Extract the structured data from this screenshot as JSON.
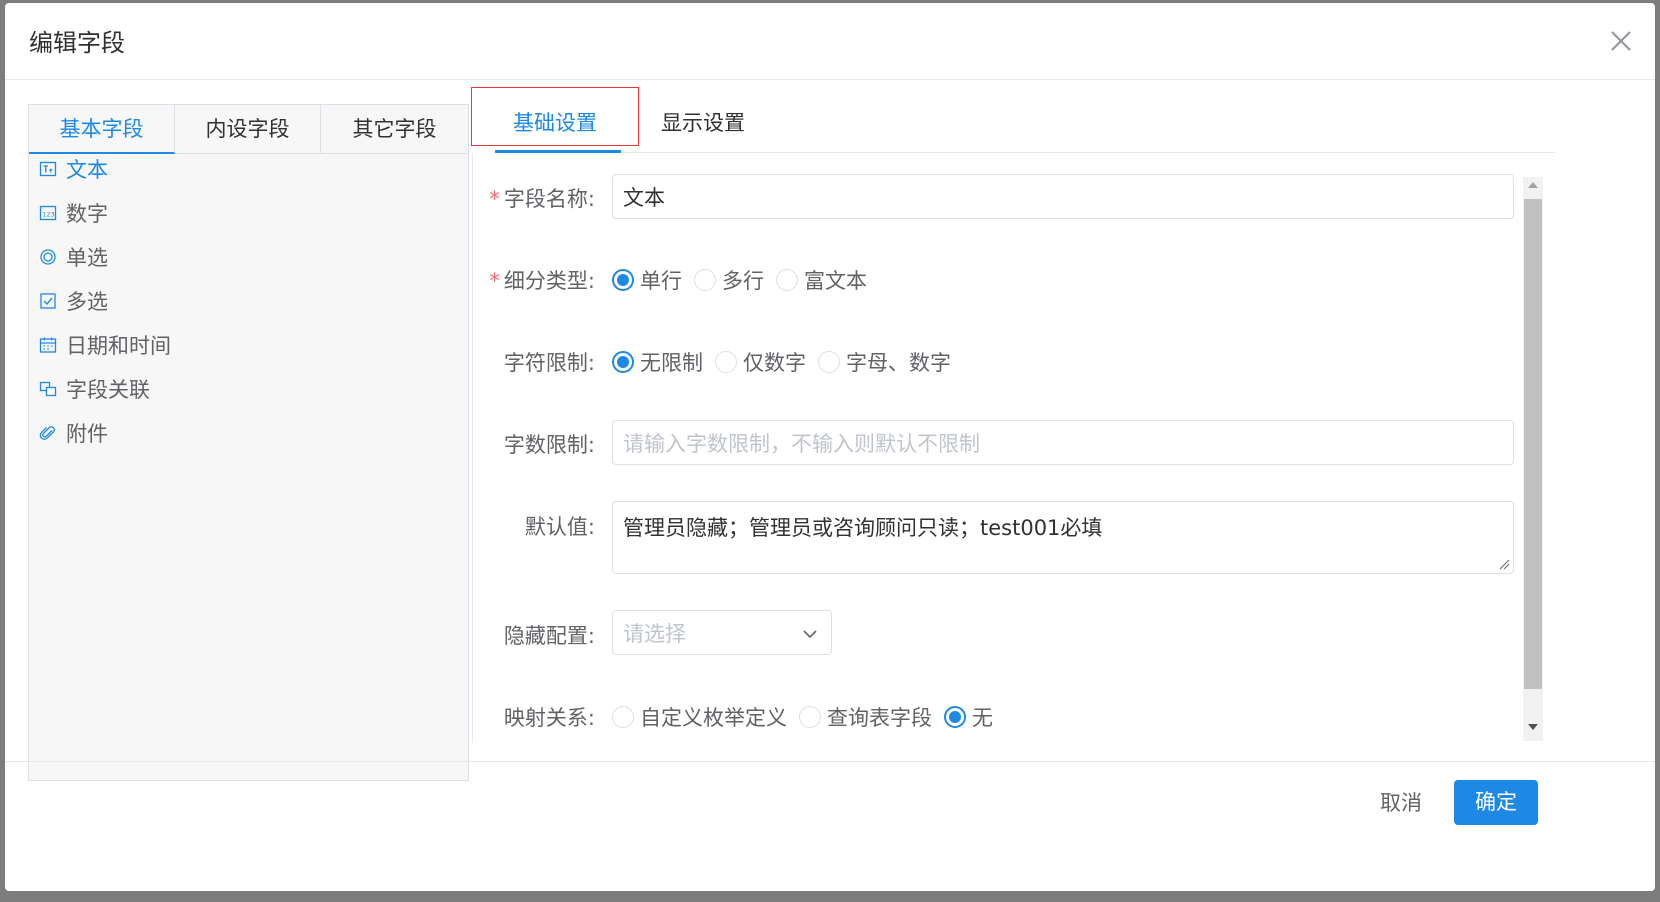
{
  "dialog": {
    "title": "编辑字段",
    "cancel_label": "取消",
    "ok_label": "确定"
  },
  "left_panel": {
    "tabs": [
      {
        "label": "基本字段",
        "active": true
      },
      {
        "label": "内设字段",
        "active": false
      },
      {
        "label": "其它字段",
        "active": false
      }
    ],
    "items": [
      {
        "label": "文本",
        "icon": "text-field-icon",
        "active": true
      },
      {
        "label": "数字",
        "icon": "number-field-icon",
        "active": false
      },
      {
        "label": "单选",
        "icon": "radio-field-icon",
        "active": false
      },
      {
        "label": "多选",
        "icon": "checkbox-field-icon",
        "active": false
      },
      {
        "label": "日期和时间",
        "icon": "calendar-icon",
        "active": false
      },
      {
        "label": "字段关联",
        "icon": "link-field-icon",
        "active": false
      },
      {
        "label": "附件",
        "icon": "paperclip-icon",
        "active": false
      }
    ]
  },
  "right_tabs": [
    {
      "label": "基础设置",
      "active": true
    },
    {
      "label": "显示设置",
      "active": false
    }
  ],
  "form": {
    "field_name": {
      "label": "字段名称:",
      "required": true,
      "value": "文本"
    },
    "sub_type": {
      "label": "细分类型:",
      "required": true,
      "options": [
        "单行",
        "多行",
        "富文本"
      ],
      "selected": "单行"
    },
    "char_limit": {
      "label": "字符限制:",
      "options": [
        "无限制",
        "仅数字",
        "字母、数字"
      ],
      "selected": "无限制"
    },
    "count_limit": {
      "label": "字数限制:",
      "placeholder": "请输入字数限制，不输入则默认不限制"
    },
    "default_value": {
      "label": "默认值:",
      "value": "管理员隐藏；管理员或咨询顾问只读；test001必填"
    },
    "hidden_config": {
      "label": "隐藏配置:",
      "placeholder": "请选择"
    },
    "mapping": {
      "label": "映射关系:",
      "options": [
        "自定义枚举定义",
        "查询表字段",
        "无"
      ],
      "selected": "无"
    }
  },
  "colors": {
    "accent": "#1e88e5",
    "required": "#f56c6c",
    "highlight_box": "#e53935"
  }
}
